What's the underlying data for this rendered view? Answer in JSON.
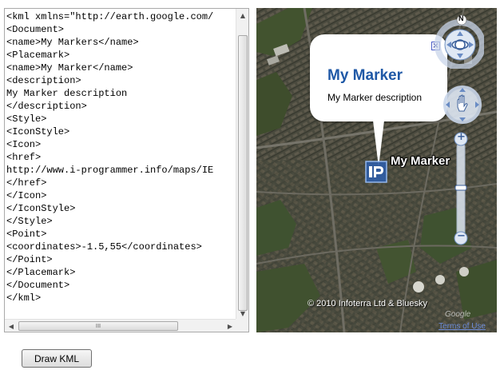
{
  "kml": {
    "lines": [
      "<kml xmlns=\"http://earth.google.com/",
      "<Document>",
      "<name>My Markers</name>",
      "<Placemark>",
      "<name>My Marker</name>",
      "<description>",
      "My Marker description",
      "</description>",
      "<Style>",
      "<IconStyle>",
      "<Icon>",
      "<href>",
      "http://www.i-programmer.info/maps/IE",
      "</href>",
      "</Icon>",
      "</IconStyle>",
      "</Style>",
      "<Point>",
      "<coordinates>-1.5,55</coordinates>",
      "</Point>",
      "</Placemark>",
      "</Document>",
      "</kml>"
    ],
    "scroll_thumb_grip": "III"
  },
  "map": {
    "balloon": {
      "title": "My Marker",
      "description": "My Marker description",
      "close_glyph": "×"
    },
    "marker_label": "My Marker",
    "compass_letter": "N",
    "zoom_in": "+",
    "zoom_out": "−",
    "copyright": "© 2010 Infoterra Ltd & Bluesky",
    "terms_link": "Terms of Use",
    "google_logo": "Google"
  },
  "button": {
    "draw_label": "Draw KML"
  }
}
